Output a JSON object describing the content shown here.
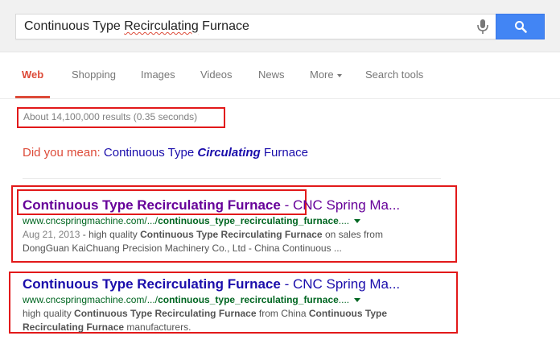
{
  "search": {
    "query_parts": [
      "Continuous Type ",
      "Recirculating",
      " Furnace"
    ]
  },
  "tabs": [
    "Web",
    "Shopping",
    "Images",
    "Videos",
    "News",
    "More",
    "Search tools"
  ],
  "stats": "About 14,100,000 results (0.35 seconds)",
  "did_you_mean": {
    "prefix": "Did you mean: ",
    "part1": "Continuous Type ",
    "emph": "Circulating",
    "part2": " Furnace"
  },
  "results": [
    {
      "title_bold": "Continuous Type Recirculating Furnace",
      "title_rest": " - CNC Spring Ma...",
      "url_prefix": "www.cncspringmachine.com/.../",
      "url_bold": "continuous_type_recirculating_furnace",
      "url_suffix": "....",
      "date": "Aug 21, 2013",
      "snip_a": " - high quality ",
      "snip_b": "Continuous Type Recirculating Furnace",
      "snip_c": " on sales from",
      "snip_line2": "DongGuan KaiChuang Precision Machinery Co., Ltd - China Continuous ..."
    },
    {
      "title_bold": "Continuous Type Recirculating Furnace",
      "title_rest": " - CNC Spring Ma...",
      "url_prefix": "www.cncspringmachine.com/.../",
      "url_bold": "continuous_type_recirculating_furnace",
      "url_suffix": "....",
      "snip_a": "high quality ",
      "snip_b": "Continuous Type Recirculating Furnace",
      "snip_c": " from China ",
      "snip_d": "Continuous Type",
      "snip_e": "Recirculating Furnace",
      "snip_f": " manufacturers."
    }
  ],
  "colors": {
    "accent": "#dd4b39",
    "link": "#1a0dab",
    "visited": "#660099",
    "url": "#006621",
    "highlight_box": "#e2191a",
    "search_button": "#4285f4"
  }
}
